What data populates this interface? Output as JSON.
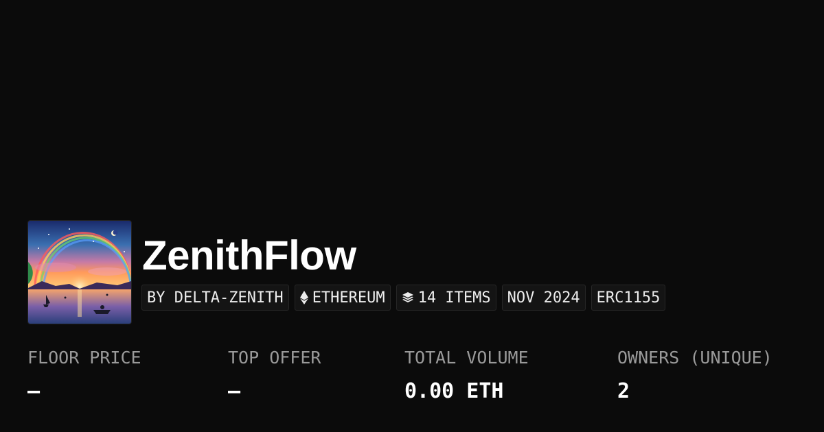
{
  "collection": {
    "name": "ZenithFlow",
    "image_icon": "sunset-lake-rainbow-artwork"
  },
  "tags": [
    {
      "icon": "",
      "label": "BY DELTA-ZENITH"
    },
    {
      "icon": "ethereum-icon",
      "label": "ETHEREUM"
    },
    {
      "icon": "layers-icon",
      "label": "14 ITEMS"
    },
    {
      "icon": "",
      "label": "NOV 2024"
    },
    {
      "icon": "",
      "label": "ERC1155"
    }
  ],
  "stats": [
    {
      "label": "FLOOR PRICE",
      "value": "—"
    },
    {
      "label": "TOP OFFER",
      "value": "—"
    },
    {
      "label": "TOTAL VOLUME",
      "value": "0.00 ETH"
    },
    {
      "label": "OWNERS (UNIQUE)",
      "value": "2"
    }
  ],
  "colors": {
    "background": "#0b0b0b",
    "text": "#ffffff",
    "muted": "#9a9a9a",
    "tag_bg": "#141414",
    "tag_border": "#262626"
  }
}
